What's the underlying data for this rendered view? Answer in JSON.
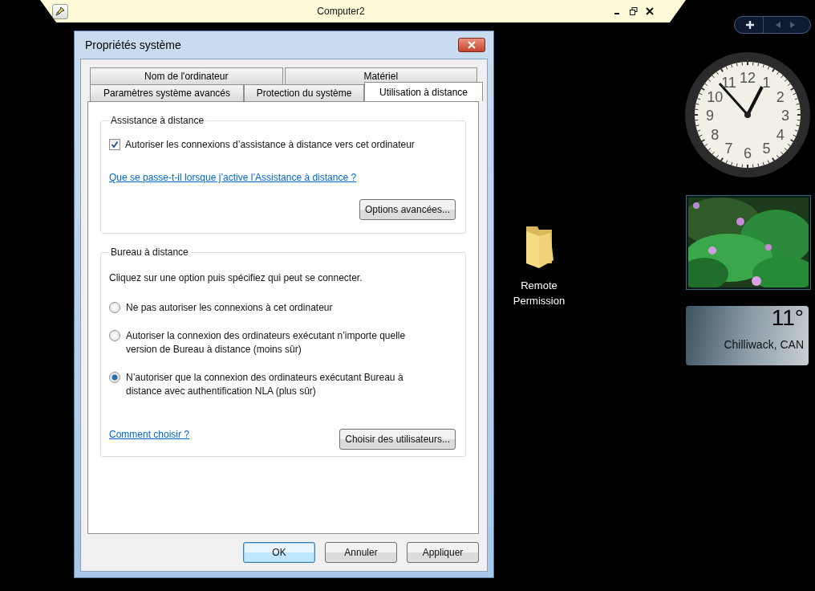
{
  "session_bar": {
    "title": "Computer2"
  },
  "dialog": {
    "title": "Propriétés système",
    "tab_rows": [
      {
        "tabs": [
          {
            "label": "Nom de l'ordinateur",
            "selected": false
          },
          {
            "label": "Matériel",
            "selected": false
          }
        ]
      },
      {
        "tabs": [
          {
            "label": "Paramètres système avancés",
            "selected": false
          },
          {
            "label": "Protection du système",
            "selected": false
          },
          {
            "label": "Utilisation à distance",
            "selected": true
          }
        ]
      }
    ],
    "remote_assistance": {
      "legend": "Assistance à distance",
      "checkbox": {
        "label": "Autoriser les connexions d’assistance à distance vers cet ordinateur",
        "checked": true
      },
      "link": "Que se passe-t-il lorsque j’active l’Assistance à distance ?",
      "button": "Options avancées..."
    },
    "remote_desktop": {
      "legend": "Bureau à distance",
      "instruction": "Cliquez sur une option puis spécifiez qui peut se connecter.",
      "options": [
        {
          "label": "Ne pas autoriser les connexions à cet ordinateur",
          "selected": false
        },
        {
          "label": "Autoriser la connexion des ordinateurs exécutant n’importe quelle version de Bureau à distance (moins sûr)",
          "selected": false
        },
        {
          "label": "N’autoriser que la connexion des ordinateurs exécutant Bureau à distance avec authentification NLA (plus sûr)",
          "selected": true
        }
      ],
      "link": "Comment choisir ?",
      "button": "Choisir des utilisateurs..."
    },
    "buttons": [
      {
        "label": "OK",
        "default": true
      },
      {
        "label": "Annuler",
        "default": false
      },
      {
        "label": "Appliquer",
        "default": false
      }
    ]
  },
  "desktop_icon": {
    "label": "Remote Permission"
  },
  "gadgets": {
    "clock": {
      "numerals": [
        "11",
        "12",
        "1",
        "10",
        "2",
        "9",
        "3",
        "8",
        "4",
        "7",
        "5",
        "6"
      ]
    },
    "weather": {
      "temperature": "11°",
      "location": "Chilliwack, CAN"
    }
  }
}
